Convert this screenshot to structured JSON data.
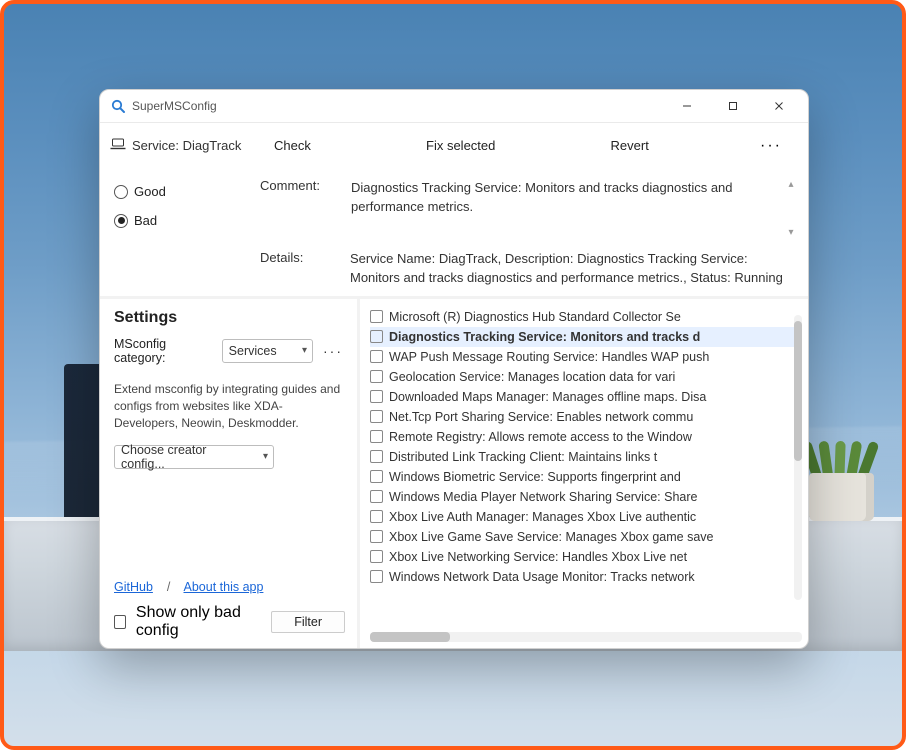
{
  "window": {
    "title": "SuperMSConfig"
  },
  "titlebar_icons": {
    "minimize": "—",
    "maximize": "▢",
    "close": "✕"
  },
  "toolbar": {
    "service_label": "Service: DiagTrack",
    "check": "Check",
    "fix": "Fix selected",
    "revert": "Revert",
    "more": "···"
  },
  "status": {
    "good_label": "Good",
    "bad_label": "Bad",
    "selected": "bad"
  },
  "info": {
    "comment_label": "Comment:",
    "comment_text": "Diagnostics Tracking Service: Monitors and tracks diagnostics and performance metrics.",
    "details_label": "Details:",
    "details_text": "Service Name: DiagTrack, Description: Diagnostics Tracking Service: Monitors and tracks diagnostics and performance metrics., Status: Running"
  },
  "settings": {
    "heading": "Settings",
    "category_label": "MSconfig category:",
    "category_value": "Services",
    "hint": "Extend msconfig by integrating guides and configs from websites like XDA-Developers, Neowin, Deskmodder.",
    "creator_value": "Choose creator config...",
    "links": {
      "github": "GitHub",
      "sep": "/",
      "about": "About this app"
    },
    "show_bad_label": "Show only bad config",
    "filter_label": "Filter"
  },
  "services": [
    {
      "text": "Microsoft (R) Diagnostics Hub Standard Collector Se",
      "selected": false
    },
    {
      "text": "Diagnostics Tracking Service: Monitors and tracks d",
      "selected": true
    },
    {
      "text": "WAP Push Message Routing Service: Handles WAP push ",
      "selected": false
    },
    {
      "text": "Geolocation Service: Manages location data for vari",
      "selected": false
    },
    {
      "text": "Downloaded Maps Manager: Manages offline maps. Disa",
      "selected": false
    },
    {
      "text": "Net.Tcp Port Sharing Service: Enables network commu",
      "selected": false
    },
    {
      "text": "Remote Registry: Allows remote access to the Window",
      "selected": false
    },
    {
      "text": "Distributed Link Tracking Client: Maintains links t",
      "selected": false
    },
    {
      "text": "Windows Biometric Service: Supports fingerprint and",
      "selected": false
    },
    {
      "text": "Windows Media Player Network Sharing Service: Share",
      "selected": false
    },
    {
      "text": "Xbox Live Auth Manager: Manages Xbox Live authentic",
      "selected": false
    },
    {
      "text": "Xbox Live Game Save Service: Manages Xbox game save",
      "selected": false
    },
    {
      "text": "Xbox Live Networking Service: Handles Xbox Live net",
      "selected": false
    },
    {
      "text": "Windows Network Data Usage Monitor: Tracks network ",
      "selected": false
    }
  ]
}
